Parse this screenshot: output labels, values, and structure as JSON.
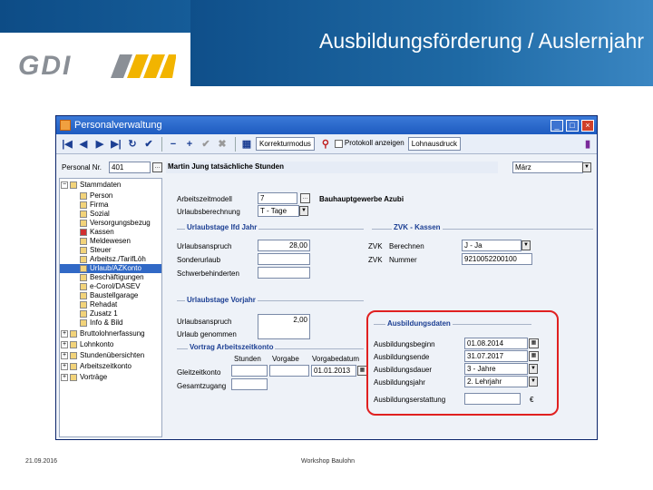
{
  "slide": {
    "title": "Ausbildungsförderung / Auslernjahr",
    "logo": "GDI",
    "footer_date": "21.09.2016",
    "footer_text": "Workshop Baulohn"
  },
  "window": {
    "title": "Personalverwaltung",
    "toolbar": {
      "mode_box": "Korrekturmodus",
      "protokoll_label": "Protokoll anzeigen",
      "print_box": "Lohnausdruck"
    }
  },
  "personal": {
    "label": "Personal Nr.",
    "number": "401",
    "name": "Martin Jung tatsächliche Stunden",
    "month": "März"
  },
  "tree": {
    "root": "Stammdaten",
    "items": [
      "Person",
      "Firma",
      "Sozial",
      "Versorgungsbezug",
      "Kassen",
      "Meldewesen",
      "Steuer",
      "Arbeitsz./TarifLöh",
      "Urlaub/AZKonto",
      "Beschäftigungen",
      "e-Corol/DASEV",
      "Baustellgarage",
      "Rehadat",
      "Zusatz 1",
      "Info & Bild"
    ],
    "groups": [
      "Bruttolohnerfassung",
      "Lohnkonto",
      "Stundenübersichten",
      "Arbeitszeitkonto",
      "Vorträge"
    ]
  },
  "form": {
    "arbeitszeitmodell_label": "Arbeitszeitmodell",
    "arbeitszeitmodell_value": "7",
    "bauhauptgewerbe": "Bauhauptgewerbe Azubi",
    "urlaubsberechnung_label": "Urlaubsberechnung",
    "urlaubsberechnung_value": "T - Tage",
    "sect_urlaub_jahr": "Urlaubstage lfd Jahr",
    "sect_zvk": "ZVK - Kassen",
    "urlaubsanspruch_label": "Urlaubsanspruch",
    "urlaubsanspruch_value": "28,00",
    "sonderurlaub_label": "Sonderurlaub",
    "schwerbehinderten_label": "Schwerbehinderten",
    "zvk_berechnen_label": "Berechnen",
    "zvk_berechnen_value": "J - Ja",
    "zvk_nummer_label": "Nummer",
    "zvk_nummer_value": "9210052200100",
    "zvk_prefix": "ZVK",
    "sect_urlaub_vorjahr": "Urlaubstage Vorjahr",
    "vj_urlaubsanspruch_label": "Urlaubsanspruch",
    "vj_urlaubsanspruch_value": "2,00",
    "vj_genommen_label": "Urlaub genommen",
    "sect_vortrag": "Vortrag Arbeitszeitkonto",
    "col_stunden": "Stunden",
    "col_vorgabe": "Vorgabe",
    "col_vorgabedatum": "Vorgabedatum",
    "gleitzeit_label": "Gleitzeitkonto",
    "gleitzeit_date": "01.01.2013",
    "gesamtzugang_label": "Gesamtzugang",
    "sect_ausbildung": "Ausbildungsdaten",
    "beginn_label": "Ausbildungsbeginn",
    "beginn_value": "01.08.2014",
    "ende_label": "Ausbildungsende",
    "ende_value": "31.07.2017",
    "dauer_label": "Ausbildungsdauer",
    "dauer_value": "3 - Jahre",
    "jahr_label": "Ausbildungsjahr",
    "jahr_value": "2. Lehrjahr",
    "erstattung_label": "Ausbildungserstattung",
    "erstattung_unit": "€"
  },
  "colors": {
    "highlight": "#e02020",
    "selection": "#3169c6",
    "section_text": "#1c3f93"
  }
}
